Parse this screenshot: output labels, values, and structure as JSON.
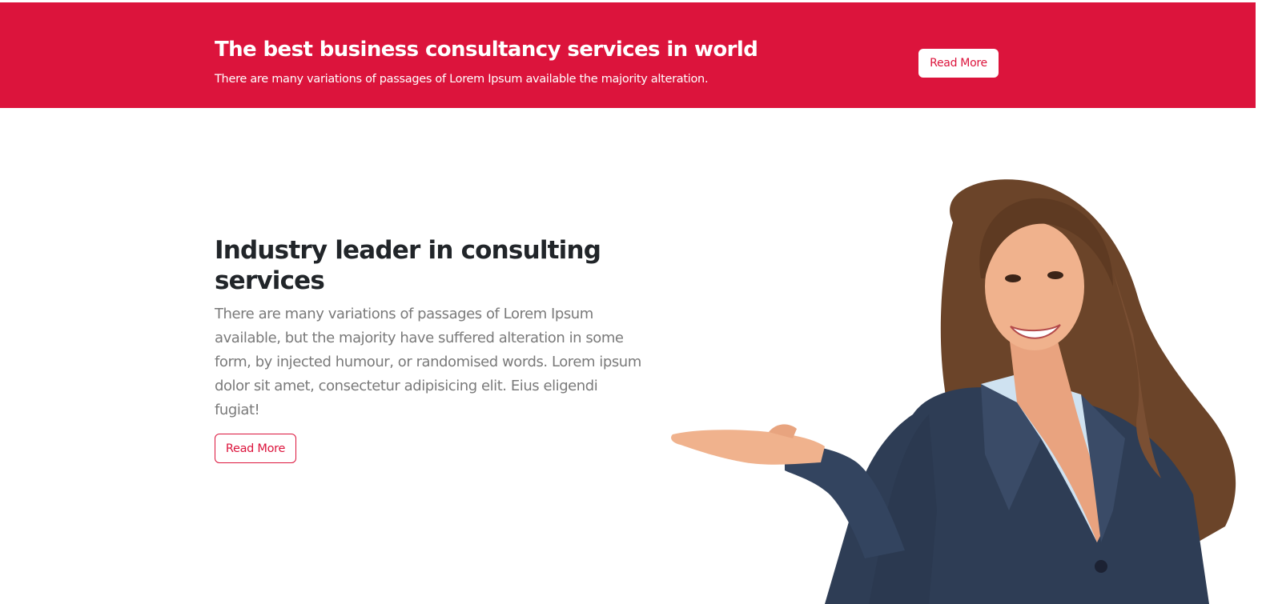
{
  "banner": {
    "title": "The best business consultancy services in world",
    "subtitle": "There are many variations of passages of Lorem Ipsum available the majority alteration.",
    "button_label": "Read More"
  },
  "feature": {
    "title": "Industry leader in consulting services",
    "body": "There are many variations of passages of Lorem Ipsum available, but the majority have suffered alteration in some form, by injected humour, or randomised words. Lorem ipsum dolor sit amet, consectetur adipisicing elit. Eius eligendi fugiat!",
    "button_label": "Read More"
  },
  "colors": {
    "accent": "#dc143c",
    "heading": "#212529",
    "body_text": "#7a7a7a",
    "background": "#ffffff"
  }
}
